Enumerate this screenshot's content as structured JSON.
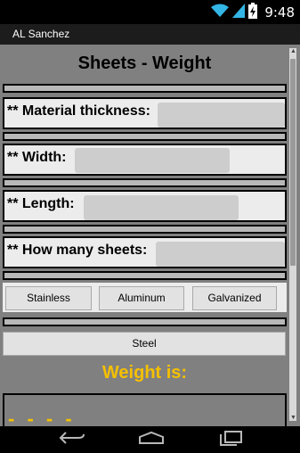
{
  "status_bar": {
    "time": "9:48",
    "icons": [
      "wifi-icon",
      "signal-icon",
      "battery-charging-icon"
    ]
  },
  "app": {
    "title": "AL Sanchez"
  },
  "main": {
    "title": "Sheets - Weight",
    "fields": [
      {
        "label": "** Material thickness:",
        "value": ""
      },
      {
        "label": "** Width:",
        "value": ""
      },
      {
        "label": "** Length:",
        "value": ""
      },
      {
        "label": "** How many sheets:",
        "value": ""
      }
    ],
    "material_buttons": [
      "Stainless",
      "Aluminum",
      "Galvanized"
    ],
    "steel_button": "Steel",
    "result_label": "Weight is:",
    "result_value": "- - - -"
  },
  "colors": {
    "background": "#808080",
    "accent": "#f5c000",
    "field_background": "#ececec"
  },
  "nav_bar": {
    "icons": [
      "back-icon",
      "home-icon",
      "recent-apps-icon"
    ]
  }
}
